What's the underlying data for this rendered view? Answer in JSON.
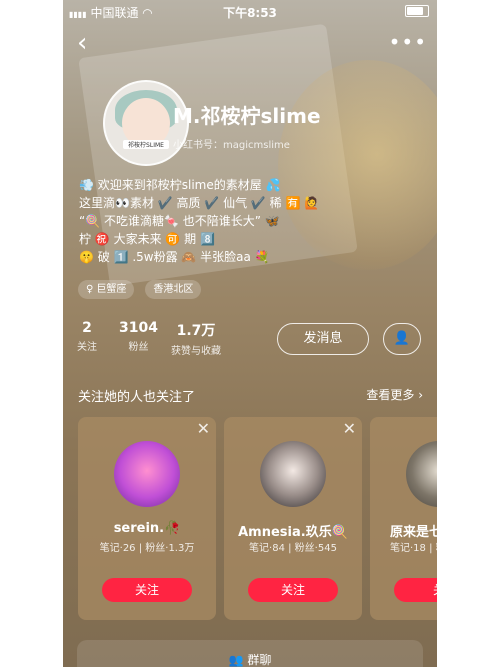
{
  "status_bar": {
    "signal": "▮▮▮▮",
    "carrier": "中国联通",
    "wifi": "◠",
    "time": "下午8:53"
  },
  "nav": {
    "back": "‹",
    "more": "•••"
  },
  "profile": {
    "avatar_tag": "祁桉柠SLIME",
    "name": "M.祁桉柠slime",
    "red_id": "小红书号：magicmslime",
    "bio": [
      "💨 欢迎来到祁桉柠slime的素材屋 💦",
      "这里滴👀素材 ✔️ 高质 ✔️ 仙气 ✔️ 稀 🈶 🙋",
      "“🍭 不吃谁滴糖🍬 也不陪谁长大” 🦋",
      "柠 ㊗️ 大家未来 🉑 期 8️⃣",
      "🤫 破 1️⃣ .5w粉露 🙈 半张脸aa 💐"
    ],
    "tags": [
      {
        "icon": "♀",
        "label": "巨蟹座"
      },
      {
        "icon": "",
        "label": "香港北区"
      }
    ]
  },
  "stats": [
    {
      "value": "2",
      "label": "关注"
    },
    {
      "value": "3104",
      "label": "粉丝"
    },
    {
      "value": "1.7万",
      "label": "获赞与收藏"
    }
  ],
  "buttons": {
    "message": "发消息",
    "user_icon": "👤"
  },
  "recommend": {
    "title": "关注她的人也关注了",
    "see_more": "查看更多 ›",
    "cards": [
      {
        "name": "serein.🥀",
        "info": "笔记·26 | 粉丝·1.3万",
        "follow": "关注",
        "close": "✕"
      },
      {
        "name": "Amnesia.玖乐🍭",
        "info": "笔记·84 | 粉丝·545",
        "follow": "关注",
        "close": "✕"
      },
      {
        "name": "原来是七",
        "info": "笔记·18 | 粉",
        "follow": "关",
        "close": ""
      }
    ]
  },
  "bottom_bar": {
    "label": "群聊",
    "icon": "👥"
  },
  "colors": {
    "accent": "#ff2442"
  }
}
